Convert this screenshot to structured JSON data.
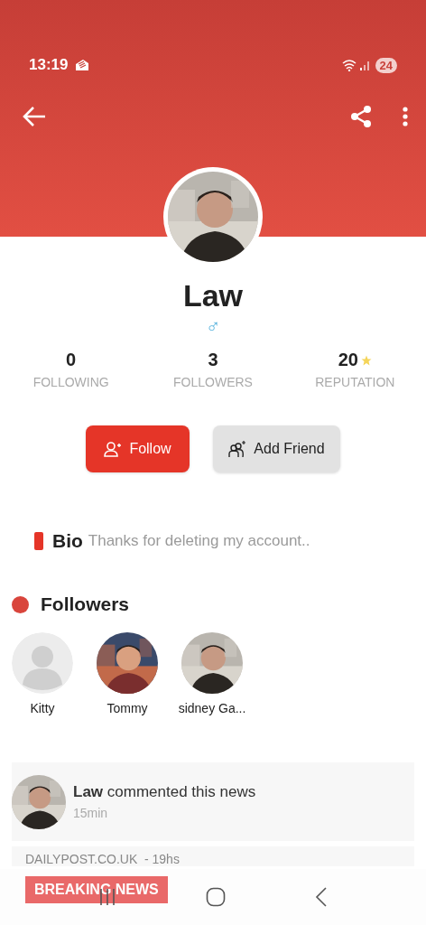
{
  "status_bar": {
    "time": "13:19",
    "battery": "24"
  },
  "profile": {
    "name": "Law",
    "gender_symbol": "♂",
    "stats": [
      {
        "value": "0",
        "label": "FOLLOWING",
        "kind": "plain"
      },
      {
        "value": "3",
        "label": "FOLLOWERS",
        "kind": "plain"
      },
      {
        "value": "20",
        "label": "REPUTATION",
        "kind": "rated"
      }
    ]
  },
  "buttons": [
    {
      "label": "Follow",
      "kind": "primary"
    },
    {
      "label": "Add Friend",
      "kind": "secondary"
    }
  ],
  "bio": {
    "label": "Bio",
    "text": "Thanks for deleting my account.."
  },
  "followers": {
    "title": "Followers",
    "items": [
      {
        "name": "Kitty",
        "kind": "placeholder"
      },
      {
        "name": "Tommy",
        "kind": "picture"
      },
      {
        "name": "sidney Ga...",
        "kind": "picture"
      }
    ]
  },
  "activity": {
    "text": "**Law** commented this news",
    "time": "15min"
  },
  "news": {
    "source": "DAILYPOST.CO.UK  - 19hs",
    "tag": "BREAKING NEWS"
  }
}
